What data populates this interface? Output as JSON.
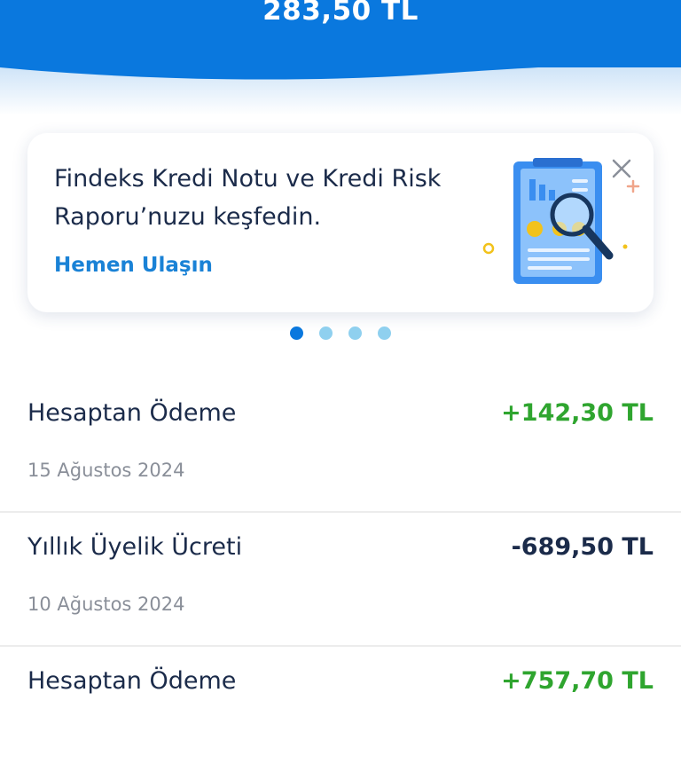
{
  "header": {
    "balance": "283,50 TL"
  },
  "promo": {
    "title": "Findeks Kredi Notu ve Kredi Risk Raporu’nuzu keşfedin.",
    "link_label": "Hemen Ulaşın",
    "illustration_icon": "magnifier-report-icon",
    "close_icon": "close-icon",
    "pager": {
      "total": 4,
      "active": 1
    }
  },
  "transactions": [
    {
      "title": "Hesaptan Ödeme",
      "date": "15 Ağustos 2024",
      "amount": "+142,30 TL",
      "type": "credit"
    },
    {
      "title": "Yıllık Üyelik Ücreti",
      "date": "10 Ağustos 2024",
      "amount": "-689,50 TL",
      "type": "debit"
    },
    {
      "title": "Hesaptan Ödeme",
      "date": "",
      "amount": "+757,70 TL",
      "type": "credit"
    }
  ],
  "colors": {
    "brand": "#0a78de",
    "positive": "#2fa52f",
    "text": "#1b2b4a",
    "muted": "#8a8f99",
    "link": "#1a82d6"
  }
}
